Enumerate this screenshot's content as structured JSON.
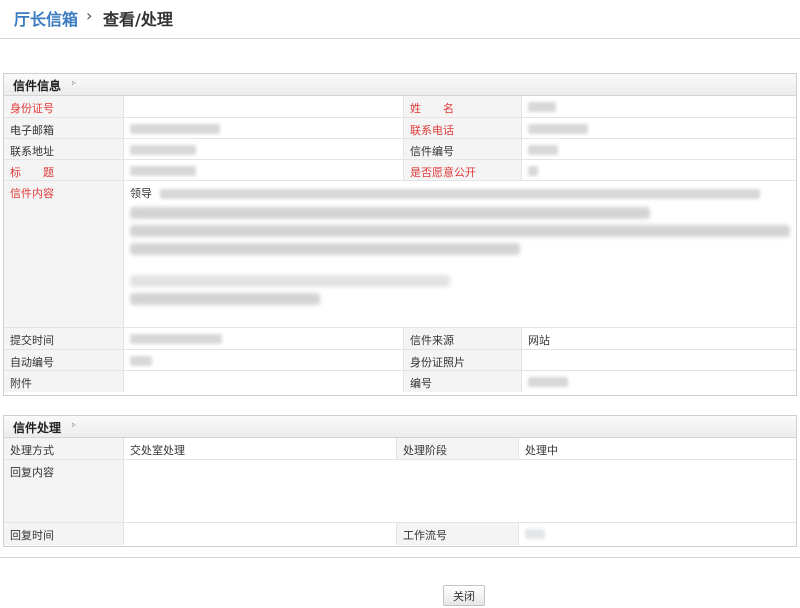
{
  "breadcrumb": {
    "root": "厅长信箱",
    "separator": "›",
    "current": "查看/处理"
  },
  "letter_info": {
    "title": "信件信息",
    "toggle": "▹",
    "fields": {
      "id_number": "身份证号",
      "name": "姓　　名",
      "email": "电子邮箱",
      "phone": "联系电话",
      "address": "联系地址",
      "letter_no": "信件编号",
      "subject": "标　　题",
      "public": "是否愿意公开",
      "content": "信件内容",
      "submit_time": "提交时间",
      "source": "信件来源",
      "auto_no": "自动编号",
      "id_photo": "身份证照片",
      "attachment": "附件",
      "number": "编号"
    },
    "values": {
      "source": "网站",
      "content_lead": "领导"
    }
  },
  "letter_process": {
    "title": "信件处理",
    "toggle": "▹",
    "fields": {
      "method": "处理方式",
      "stage": "处理阶段",
      "reply": "回复内容",
      "reply_time": "回复时间",
      "workflow_no": "工作流号"
    },
    "values": {
      "method": "交处室处理",
      "stage": "处理中"
    }
  },
  "buttons": {
    "close": "关闭"
  }
}
